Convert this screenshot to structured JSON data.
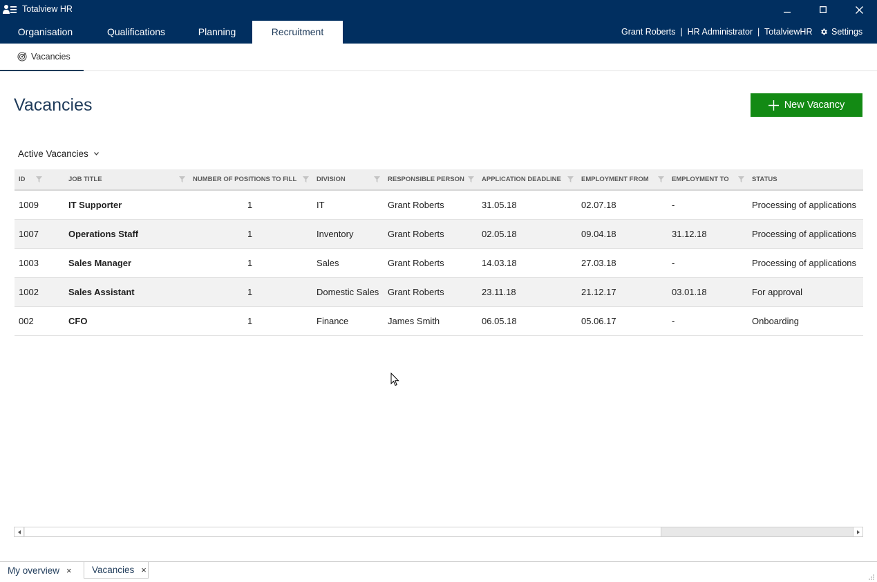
{
  "window": {
    "title": "Totalview HR"
  },
  "menu": {
    "tabs": [
      {
        "label": "Organisation"
      },
      {
        "label": "Qualifications"
      },
      {
        "label": "Planning"
      },
      {
        "label": "Recruitment"
      }
    ],
    "active_tab": "Recruitment",
    "user_info": "Grant Roberts  |  HR Administrator  |  TotalviewHR",
    "settings_label": "Settings"
  },
  "subtabs": {
    "active": "Vacancies",
    "icon": "target-icon"
  },
  "page": {
    "title": "Vacancies",
    "new_button_label": "New Vacancy",
    "filter_label": "Active Vacancies"
  },
  "grid": {
    "columns": [
      "ID",
      "JOB TITLE",
      "NUMBER OF POSITIONS TO FILL",
      "DIVISION",
      "RESPONSIBLE PERSON",
      "APPLICATION DEADLINE",
      "EMPLOYMENT FROM",
      "EMPLOYMENT TO",
      "STATUS"
    ],
    "rows": [
      {
        "id": "1009",
        "job_title": "IT Supporter",
        "positions": "1",
        "division": "IT",
        "responsible": "Grant Roberts",
        "deadline": "31.05.18",
        "from": "02.07.18",
        "to": "-",
        "status": "Processing of applications"
      },
      {
        "id": "1007",
        "job_title": "Operations Staff",
        "positions": "1",
        "division": "Inventory",
        "responsible": "Grant Roberts",
        "deadline": "02.05.18",
        "from": "09.04.18",
        "to": "31.12.18",
        "status": "Processing of applications"
      },
      {
        "id": "1003",
        "job_title": "Sales Manager",
        "positions": "1",
        "division": "Sales",
        "responsible": "Grant Roberts",
        "deadline": "14.03.18",
        "from": "27.03.18",
        "to": "-",
        "status": "Processing of applications"
      },
      {
        "id": "1002",
        "job_title": "Sales Assistant",
        "positions": "1",
        "division": "Domestic Sales",
        "responsible": "Grant Roberts",
        "deadline": "23.11.18",
        "from": "21.12.17",
        "to": "03.01.18",
        "status": "For approval"
      },
      {
        "id": "002",
        "job_title": "CFO",
        "positions": "1",
        "division": "Finance",
        "responsible": "James Smith",
        "deadline": "06.05.18",
        "from": "05.06.17",
        "to": "-",
        "status": "Onboarding"
      }
    ]
  },
  "bottom_tabs": [
    {
      "label": "My overview",
      "close": "×"
    },
    {
      "label": "Vacancies",
      "close": "×"
    }
  ],
  "colors": {
    "header_bg": "#012f60",
    "primary_button": "#138a14",
    "title_text": "#1f3b5a"
  }
}
